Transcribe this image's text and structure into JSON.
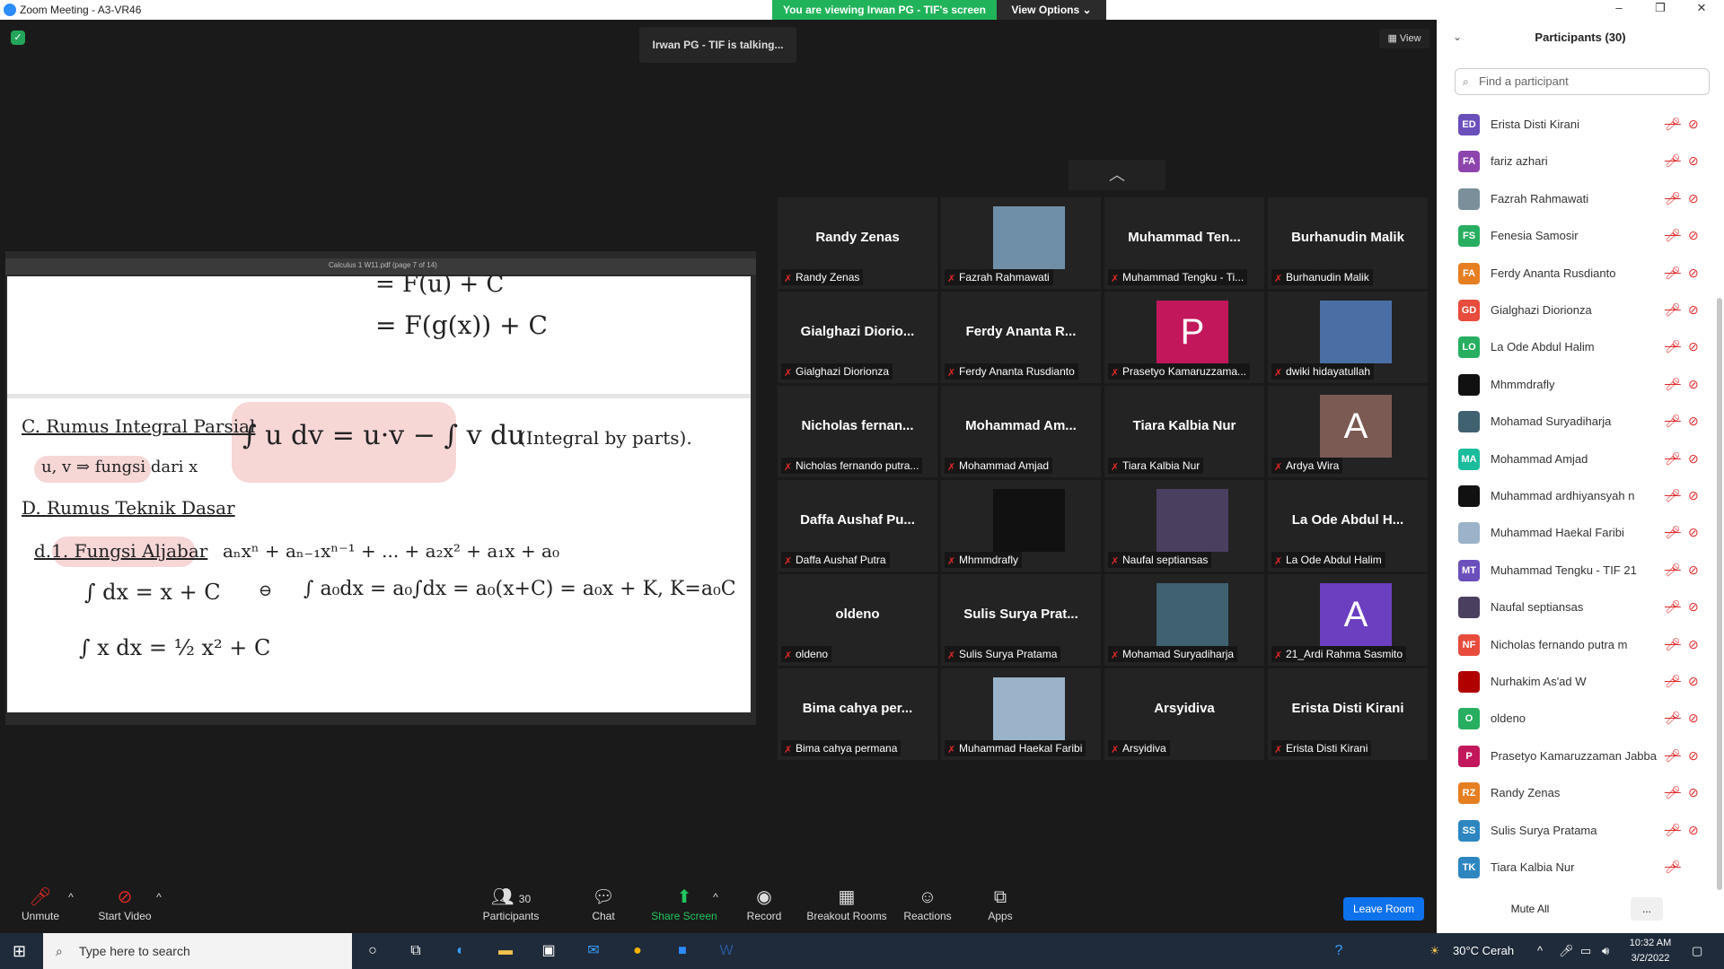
{
  "window": {
    "title": "Zoom Meeting - A3-VR46"
  },
  "banner": {
    "viewing": "You are viewing Irwan PG - TIF's screen",
    "view_options": "View Options"
  },
  "meeting": {
    "talking": "Irwan PG - TIF is talking...",
    "view_label": "View"
  },
  "tiles": [
    {
      "big": "Randy Zenas",
      "name": "Randy Zenas",
      "type": "text"
    },
    {
      "big": "",
      "name": "Fazrah Rahmawati",
      "type": "photo",
      "color": "#6f8fa8"
    },
    {
      "big": "Muhammad Ten...",
      "name": "Muhammad Tengku - Ti...",
      "type": "text"
    },
    {
      "big": "Burhanudin Malik",
      "name": "Burhanudin Malik",
      "type": "text"
    },
    {
      "big": "Gialghazi Diorio...",
      "name": "Gialghazi Diorionza",
      "type": "text"
    },
    {
      "big": "Ferdy Ananta R...",
      "name": "Ferdy Ananta Rusdianto",
      "type": "text"
    },
    {
      "big": "P",
      "name": "Prasetyo Kamaruzzama...",
      "type": "letter",
      "color": "#c2185b"
    },
    {
      "big": "",
      "name": "dwiki hidayatullah",
      "type": "photo",
      "color": "#4a6fa5"
    },
    {
      "big": "Nicholas fernan...",
      "name": "Nicholas fernando putra...",
      "type": "text"
    },
    {
      "big": "Mohammad Am...",
      "name": "Mohammad Amjad",
      "type": "text"
    },
    {
      "big": "Tiara Kalbia Nur",
      "name": "Tiara Kalbia Nur",
      "type": "text"
    },
    {
      "big": "A",
      "name": "Ardya Wira",
      "type": "letter",
      "color": "#7b5a54"
    },
    {
      "big": "Daffa Aushaf Pu...",
      "name": "Daffa Aushaf Putra",
      "type": "text"
    },
    {
      "big": "",
      "name": "Mhmmdrafly",
      "type": "photo",
      "color": "#111111"
    },
    {
      "big": "",
      "name": "Naufal septiansas",
      "type": "photo",
      "color": "#4b3f5f"
    },
    {
      "big": "La Ode Abdul H...",
      "name": "La Ode Abdul Halim",
      "type": "text"
    },
    {
      "big": "oldeno",
      "name": "oldeno",
      "type": "text"
    },
    {
      "big": "Sulis Surya Prat...",
      "name": "Sulis Surya Pratama",
      "type": "text"
    },
    {
      "big": "",
      "name": "Mohamad Suryadiharja",
      "type": "photo",
      "color": "#3f6170"
    },
    {
      "big": "A",
      "name": "21_Ardi Rahma Sasmito",
      "type": "letter",
      "color": "#6b3fbf"
    },
    {
      "big": "Bima cahya per...",
      "name": "Bima cahya permana",
      "type": "text"
    },
    {
      "big": "",
      "name": "Muhammad Haekal Faribi",
      "type": "photo",
      "color": "#9ab3c8"
    },
    {
      "big": "Arsyidiva",
      "name": "Arsyidiva",
      "type": "text"
    },
    {
      "big": "Erista Disti Kirani",
      "name": "Erista Disti Kirani",
      "type": "text"
    }
  ],
  "share": {
    "doc_title": "Calculus 1 W11.pdf (page 7 of 14)",
    "lines": [
      "= F(u) + C",
      "= F(g(x)) + C",
      "C. Rumus Integral Parsial",
      "∫ u dv = u·v − ∫ v du",
      "(Integral by parts).",
      "u, v ⇒ fungsi dari x",
      "D. Rumus Teknik Dasar",
      "d.1. Fungsi Aljabar",
      "aₙxⁿ + aₙ₋₁xⁿ⁻¹ + ... + a₂x² + a₁x + a₀",
      "∫ dx = x + C",
      "⊖",
      "∫ a₀dx = a₀∫dx = a₀(x+C) = a₀x + K,  K=a₀C",
      "∫ x dx = ½ x² + C"
    ]
  },
  "toolbar": {
    "unmute": "Unmute",
    "start_video": "Start Video",
    "participants": "Participants",
    "participants_count": "30",
    "chat": "Chat",
    "share_screen": "Share Screen",
    "record": "Record",
    "breakout": "Breakout Rooms",
    "reactions": "Reactions",
    "apps": "Apps",
    "leave": "Leave Room"
  },
  "panel": {
    "title": "Participants (30)",
    "search_placeholder": "Find a participant",
    "mute_all": "Mute All",
    "more": "...",
    "participants": [
      {
        "initials": "ED",
        "name": "Erista Disti Kirani",
        "color": "#6b4fbb",
        "cam": true
      },
      {
        "initials": "FA",
        "name": "fariz azhari",
        "color": "#8e44ad",
        "cam": true
      },
      {
        "initials": "",
        "name": "Fazrah Rahmawati",
        "color": "#7a8f9a",
        "cam": true
      },
      {
        "initials": "FS",
        "name": "Fenesia Samosir",
        "color": "#27ae60",
        "cam": true
      },
      {
        "initials": "FA",
        "name": "Ferdy Ananta Rusdianto",
        "color": "#e67e22",
        "cam": true
      },
      {
        "initials": "GD",
        "name": "Gialghazi Diorionza",
        "color": "#e74c3c",
        "cam": true
      },
      {
        "initials": "LO",
        "name": "La Ode Abdul Halim",
        "color": "#27ae60",
        "cam": true
      },
      {
        "initials": "",
        "name": "Mhmmdrafly",
        "color": "#111111",
        "cam": true
      },
      {
        "initials": "",
        "name": "Mohamad Suryadiharja",
        "color": "#3f6170",
        "cam": true
      },
      {
        "initials": "MA",
        "name": "Mohammad Amjad",
        "color": "#1abc9c",
        "cam": true
      },
      {
        "initials": "",
        "name": "Muhammad ardhiyansyah n",
        "color": "#111111",
        "cam": true
      },
      {
        "initials": "",
        "name": "Muhammad Haekal Faribi",
        "color": "#9ab3c8",
        "cam": true
      },
      {
        "initials": "MT",
        "name": "Muhammad Tengku - TIF 21",
        "color": "#6b4fbb",
        "cam": true
      },
      {
        "initials": "",
        "name": "Naufal septiansas",
        "color": "#4b3f5f",
        "cam": true
      },
      {
        "initials": "NF",
        "name": "Nicholas fernando putra m",
        "color": "#e74c3c",
        "cam": true
      },
      {
        "initials": "",
        "name": "Nurhakim As'ad W",
        "color": "#b00000",
        "cam": true
      },
      {
        "initials": "O",
        "name": "oldeno",
        "color": "#27ae60",
        "cam": true
      },
      {
        "initials": "P",
        "name": "Prasetyo Kamaruzzaman Jabba",
        "color": "#c2185b",
        "cam": true
      },
      {
        "initials": "RZ",
        "name": "Randy Zenas",
        "color": "#e67e22",
        "cam": true
      },
      {
        "initials": "SS",
        "name": "Sulis Surya Pratama",
        "color": "#2e86c1",
        "cam": true
      },
      {
        "initials": "TK",
        "name": "Tiara Kalbia Nur",
        "color": "#2e86c1",
        "cam": false
      }
    ]
  },
  "taskbar": {
    "search_placeholder": "Type here to search",
    "weather": "30°C  Cerah",
    "time": "10:32 AM",
    "date": "3/2/2022"
  }
}
